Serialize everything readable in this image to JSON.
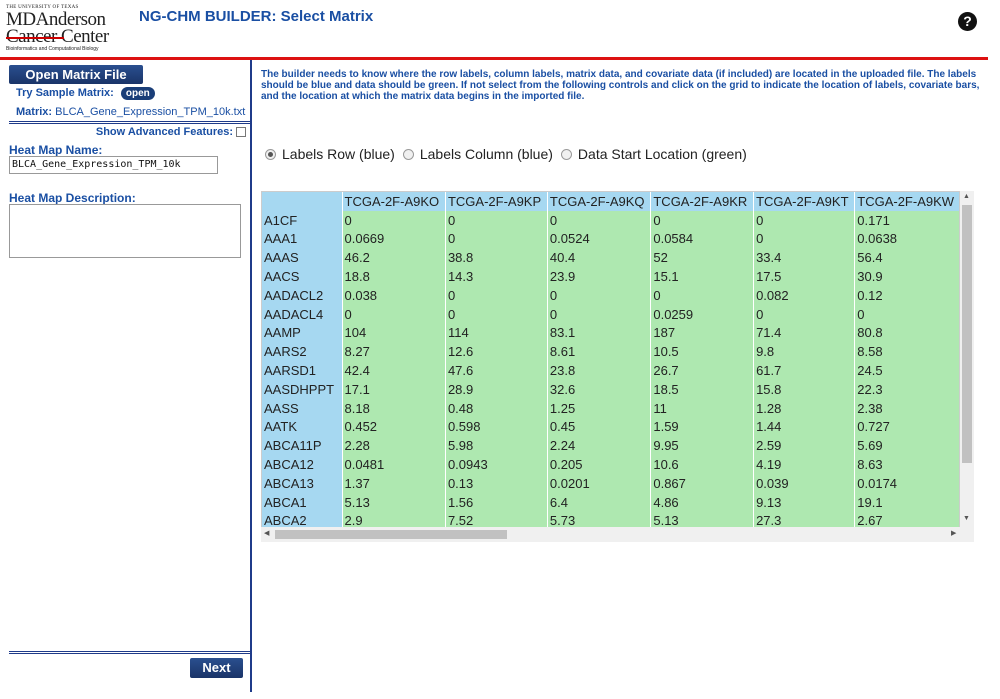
{
  "header": {
    "logo_line1": "THE UNIVERSITY OF TEXAS",
    "logo_line2": "MDAnderson",
    "logo_line3": "Cancer Center",
    "logo_line4": "Bioinformatics and Computational Biology",
    "title": "NG-CHM BUILDER: Select Matrix",
    "help_label": "?"
  },
  "sidebar": {
    "open_matrix_label": "Open Matrix File",
    "try_sample_label": "Try Sample Matrix:",
    "open_label": "open",
    "matrix_label": "Matrix:",
    "matrix_file": "BLCA_Gene_Expression_TPM_10k.txt",
    "show_advanced_label": "Show Advanced Features:",
    "heat_map_name_label": "Heat Map Name:",
    "heat_map_name_value": "BLCA_Gene_Expression_TPM_10k",
    "heat_map_description_label": "Heat Map Description:",
    "next_label": "Next"
  },
  "main": {
    "instructions": "The builder needs to know where the row labels, column labels, matrix data, and covariate data (if included) are located in the uploaded file. The labels should be blue and data should be green. If not select from the following controls and click on the grid to indicate the location of labels, covariate bars, and the location at which the matrix data begins in the imported file.",
    "radio_options": [
      "Labels Row (blue)",
      "Labels Column (blue)",
      "Data Start Location (green)"
    ],
    "selected_radio": 0
  },
  "grid": {
    "columns": [
      "TCGA-2F-A9KO",
      "TCGA-2F-A9KP",
      "TCGA-2F-A9KQ",
      "TCGA-2F-A9KR",
      "TCGA-2F-A9KT",
      "TCGA-2F-A9KW"
    ],
    "rows": [
      {
        "label": "A1CF",
        "values": [
          "0",
          "0",
          "0",
          "0",
          "0",
          "0.171"
        ]
      },
      {
        "label": "AAA1",
        "values": [
          "0.0669",
          "0",
          "0.0524",
          "0.0584",
          "0",
          "0.0638"
        ]
      },
      {
        "label": "AAAS",
        "values": [
          "46.2",
          "38.8",
          "40.4",
          "52",
          "33.4",
          "56.4"
        ]
      },
      {
        "label": "AACS",
        "values": [
          "18.8",
          "14.3",
          "23.9",
          "15.1",
          "17.5",
          "30.9"
        ]
      },
      {
        "label": "AADACL2",
        "values": [
          "0.038",
          "0",
          "0",
          "0",
          "0.082",
          "0.12"
        ]
      },
      {
        "label": "AADACL4",
        "values": [
          "0",
          "0",
          "0",
          "0.0259",
          "0",
          "0"
        ]
      },
      {
        "label": "AAMP",
        "values": [
          "104",
          "114",
          "83.1",
          "187",
          "71.4",
          "80.8"
        ]
      },
      {
        "label": "AARS2",
        "values": [
          "8.27",
          "12.6",
          "8.61",
          "10.5",
          "9.8",
          "8.58"
        ]
      },
      {
        "label": "AARSD1",
        "values": [
          "42.4",
          "47.6",
          "23.8",
          "26.7",
          "61.7",
          "24.5"
        ]
      },
      {
        "label": "AASDHPPT",
        "values": [
          "17.1",
          "28.9",
          "32.6",
          "18.5",
          "15.8",
          "22.3"
        ]
      },
      {
        "label": "AASS",
        "values": [
          "8.18",
          "0.48",
          "1.25",
          "11",
          "1.28",
          "2.38"
        ]
      },
      {
        "label": "AATK",
        "values": [
          "0.452",
          "0.598",
          "0.45",
          "1.59",
          "1.44",
          "0.727"
        ]
      },
      {
        "label": "ABCA11P",
        "values": [
          "2.28",
          "5.98",
          "2.24",
          "9.95",
          "2.59",
          "5.69"
        ]
      },
      {
        "label": "ABCA12",
        "values": [
          "0.0481",
          "0.0943",
          "0.205",
          "10.6",
          "4.19",
          "8.63"
        ]
      },
      {
        "label": "ABCA13",
        "values": [
          "1.37",
          "0.13",
          "0.0201",
          "0.867",
          "0.039",
          "0.0174"
        ]
      },
      {
        "label": "ABCA1",
        "values": [
          "5.13",
          "1.56",
          "6.4",
          "4.86",
          "9.13",
          "19.1"
        ]
      },
      {
        "label": "ABCA2",
        "values": [
          "2.9",
          "7.52",
          "5.73",
          "5.13",
          "27.3",
          "2.67"
        ]
      }
    ]
  }
}
